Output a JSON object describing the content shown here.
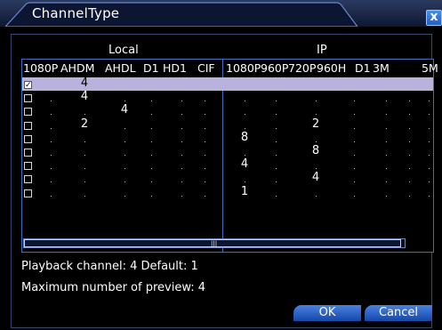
{
  "window": {
    "title": "ChannelType",
    "close_glyph": "x"
  },
  "sections": {
    "local": "Local",
    "ip": "IP"
  },
  "local_columns": [
    "1080P",
    "AHDM",
    "AHDL",
    "D1",
    "HD1",
    "CIF"
  ],
  "ip_columns": [
    "1080P",
    "960P",
    "720P",
    "960H",
    "D1",
    "3M",
    "5M"
  ],
  "rows": [
    {
      "checked": true,
      "highlighted": true,
      "local": [
        "",
        "4",
        "",
        "",
        "",
        ""
      ],
      "ip": [
        "",
        "",
        "",
        "",
        "",
        "",
        ""
      ]
    },
    {
      "checked": false,
      "highlighted": false,
      "local": [
        "",
        "4",
        "",
        "",
        "",
        ""
      ],
      "ip": [
        "",
        "",
        "",
        "",
        "",
        "",
        ""
      ]
    },
    {
      "checked": false,
      "highlighted": false,
      "local": [
        "",
        "",
        "4",
        "",
        "",
        ""
      ],
      "ip": [
        "",
        "",
        "",
        "",
        "",
        "",
        ""
      ]
    },
    {
      "checked": false,
      "highlighted": false,
      "local": [
        "",
        "2",
        "",
        "",
        "",
        ""
      ],
      "ip": [
        "",
        "",
        "2",
        "",
        "",
        "",
        ""
      ]
    },
    {
      "checked": false,
      "highlighted": false,
      "local": [
        "",
        "",
        "",
        "",
        "",
        ""
      ],
      "ip": [
        "8",
        "",
        "",
        "",
        "",
        "",
        ""
      ]
    },
    {
      "checked": false,
      "highlighted": false,
      "local": [
        "",
        "",
        "",
        "",
        "",
        ""
      ],
      "ip": [
        "",
        "",
        "8",
        "",
        "",
        "",
        ""
      ]
    },
    {
      "checked": false,
      "highlighted": false,
      "local": [
        "",
        "",
        "",
        "",
        "",
        ""
      ],
      "ip": [
        "4",
        "",
        "",
        "",
        "",
        "",
        ""
      ]
    },
    {
      "checked": false,
      "highlighted": false,
      "local": [
        "",
        "",
        "",
        "",
        "",
        ""
      ],
      "ip": [
        "",
        "",
        "4",
        "",
        "",
        "",
        ""
      ]
    },
    {
      "checked": false,
      "highlighted": false,
      "local": [
        "",
        "",
        "",
        "",
        "",
        ""
      ],
      "ip": [
        "1",
        "",
        "",
        "",
        "",
        "",
        ""
      ]
    }
  ],
  "scrollbar": {
    "grip_glyph": "|||"
  },
  "info": {
    "playback": "Playback channel: 4  Default: 1",
    "max_preview": "Maximum number of preview: 4"
  },
  "buttons": {
    "ok": "OK",
    "cancel": "Cancel"
  },
  "colors": {
    "accent": "#3e6fbf",
    "highlight_row": "#b9b2dc",
    "button": "#2a62c8"
  }
}
